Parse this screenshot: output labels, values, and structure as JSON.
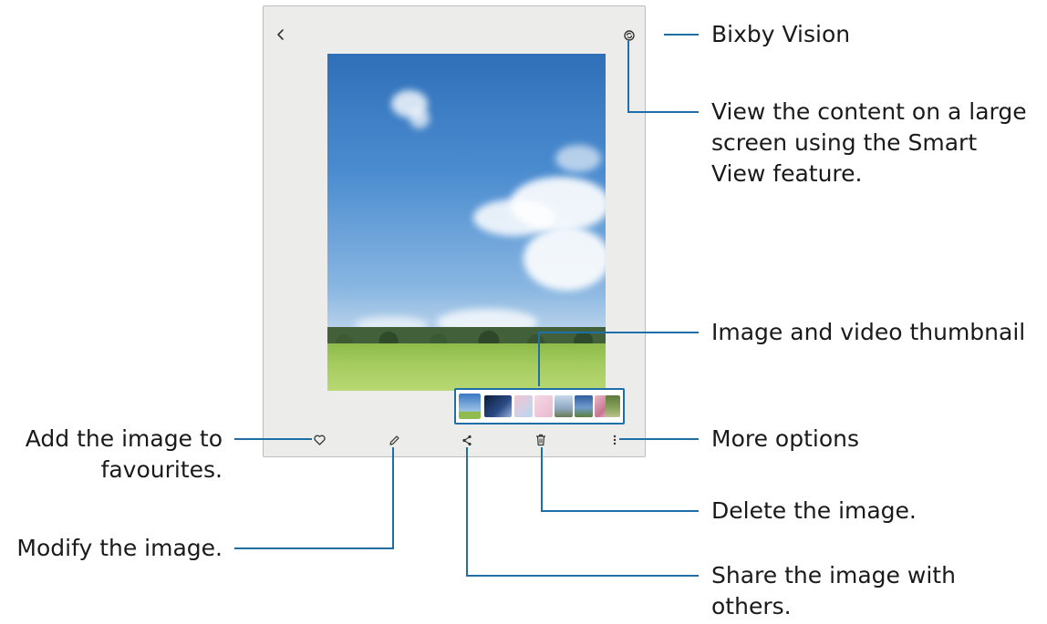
{
  "callouts": {
    "bixby_vision": "Bixby Vision",
    "smart_view": [
      "View the content on a large",
      "screen using the Smart",
      "View feature."
    ],
    "thumbnail": "Image and video thumbnail",
    "more_options": "More options",
    "delete": "Delete the image.",
    "share": [
      "Share the image with",
      "others."
    ],
    "modify": "Modify the image.",
    "favourites": [
      "Add the image to",
      "favourites."
    ]
  },
  "icons": {
    "back": "back-chevron-icon",
    "smart_view": "smart-view-icon",
    "bixby_vision": "eye-icon",
    "favourite": "heart-icon",
    "edit": "pencil-icon",
    "share": "share-icon",
    "delete": "trash-icon",
    "more": "more-vertical-icon"
  },
  "colors": {
    "leader_line": "#1e6fa8",
    "device_background": "#ecedeb"
  }
}
